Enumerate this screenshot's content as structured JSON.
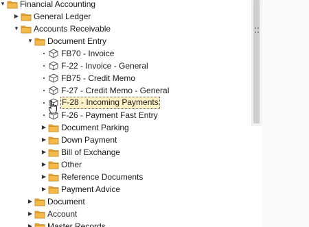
{
  "tree": [
    {
      "label": "Financial Accounting",
      "type": "folder",
      "expanded": true,
      "level": 0
    },
    {
      "label": "General Ledger",
      "type": "folder",
      "expanded": false,
      "level": 1
    },
    {
      "label": "Accounts Receivable",
      "type": "folder",
      "expanded": true,
      "level": 1
    },
    {
      "label": "Document Entry",
      "type": "folder",
      "expanded": true,
      "level": 2
    },
    {
      "label": "FB70 - Invoice",
      "type": "transaction",
      "level": 3
    },
    {
      "label": "F-22 - Invoice - General",
      "type": "transaction",
      "level": 3
    },
    {
      "label": "FB75 - Credit Memo",
      "type": "transaction",
      "level": 3
    },
    {
      "label": "F-27 - Credit Memo - General",
      "type": "transaction",
      "level": 3
    },
    {
      "label": "F-28 - Incoming Payments",
      "type": "transaction",
      "level": 3,
      "selected": true
    },
    {
      "label": "F-26 - Payment Fast Entry",
      "type": "transaction",
      "level": 3
    },
    {
      "label": "Document Parking",
      "type": "folder",
      "expanded": false,
      "level": 3
    },
    {
      "label": "Down Payment",
      "type": "folder",
      "expanded": false,
      "level": 3
    },
    {
      "label": "Bill of Exchange",
      "type": "folder",
      "expanded": false,
      "level": 3
    },
    {
      "label": "Other",
      "type": "folder",
      "expanded": false,
      "level": 3
    },
    {
      "label": "Reference Documents",
      "type": "folder",
      "expanded": false,
      "level": 3
    },
    {
      "label": "Payment Advice",
      "type": "folder",
      "expanded": false,
      "level": 3
    },
    {
      "label": "Document",
      "type": "folder",
      "expanded": false,
      "level": 2
    },
    {
      "label": "Account",
      "type": "folder",
      "expanded": false,
      "level": 2
    },
    {
      "label": "Master Records",
      "type": "folder",
      "expanded": false,
      "level": 2
    }
  ],
  "icons": {
    "folder": "folder-icon",
    "transaction": "transaction-cube-icon",
    "expanded": "expanded-arrow-icon",
    "collapsed": "collapsed-arrow-icon",
    "cursor": "mouse-pointer-icon"
  },
  "colors": {
    "folder_fill": "#f3b94a",
    "folder_tab": "#e9a531",
    "folder_stroke": "#c98a22",
    "selected_bg": "#fff1c8"
  }
}
